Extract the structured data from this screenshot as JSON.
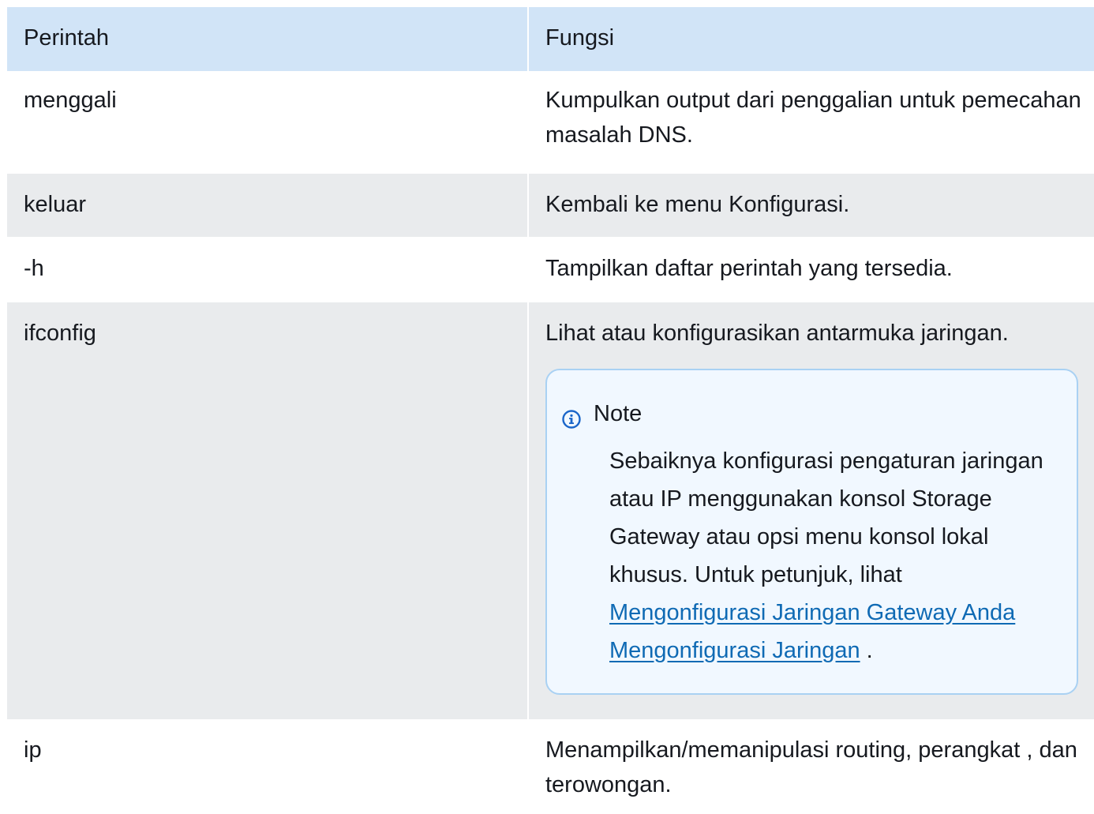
{
  "table": {
    "headers": [
      "Perintah",
      "Fungsi"
    ],
    "rows": [
      {
        "command": "menggali",
        "function": "Kumpulkan output dari penggalian untuk pemecahan masalah DNS."
      },
      {
        "command": "keluar",
        "function": "Kembali ke menu Konfigurasi."
      },
      {
        "command": "-h",
        "function": "Tampilkan daftar perintah yang tersedia."
      },
      {
        "command": "ifconfig",
        "function": "Lihat atau konfigurasikan antarmuka jaringan."
      },
      {
        "command": "ip",
        "function": "Menampilkan/memanipulasi routing, perangkat , dan terowongan."
      }
    ]
  },
  "note": {
    "title": "Note",
    "icon": "info-icon",
    "body_text": "Sebaiknya konfigurasi pengaturan jaringan atau IP menggunakan konsol Storage Gateway atau opsi menu konsol lokal khusus. Untuk petunjuk, lihat",
    "link_text": "Mengonfigurasi Jaringan Gateway Anda Mengonfigurasi Jaringan",
    "trailing": "."
  },
  "colors": {
    "header_bg": "#d1e4f7",
    "striped_row_bg": "#e9ebed",
    "note_border": "#a9d1f3",
    "note_bg": "#f1f8ff",
    "link": "#0f6ab4",
    "icon": "#1b66c9"
  }
}
